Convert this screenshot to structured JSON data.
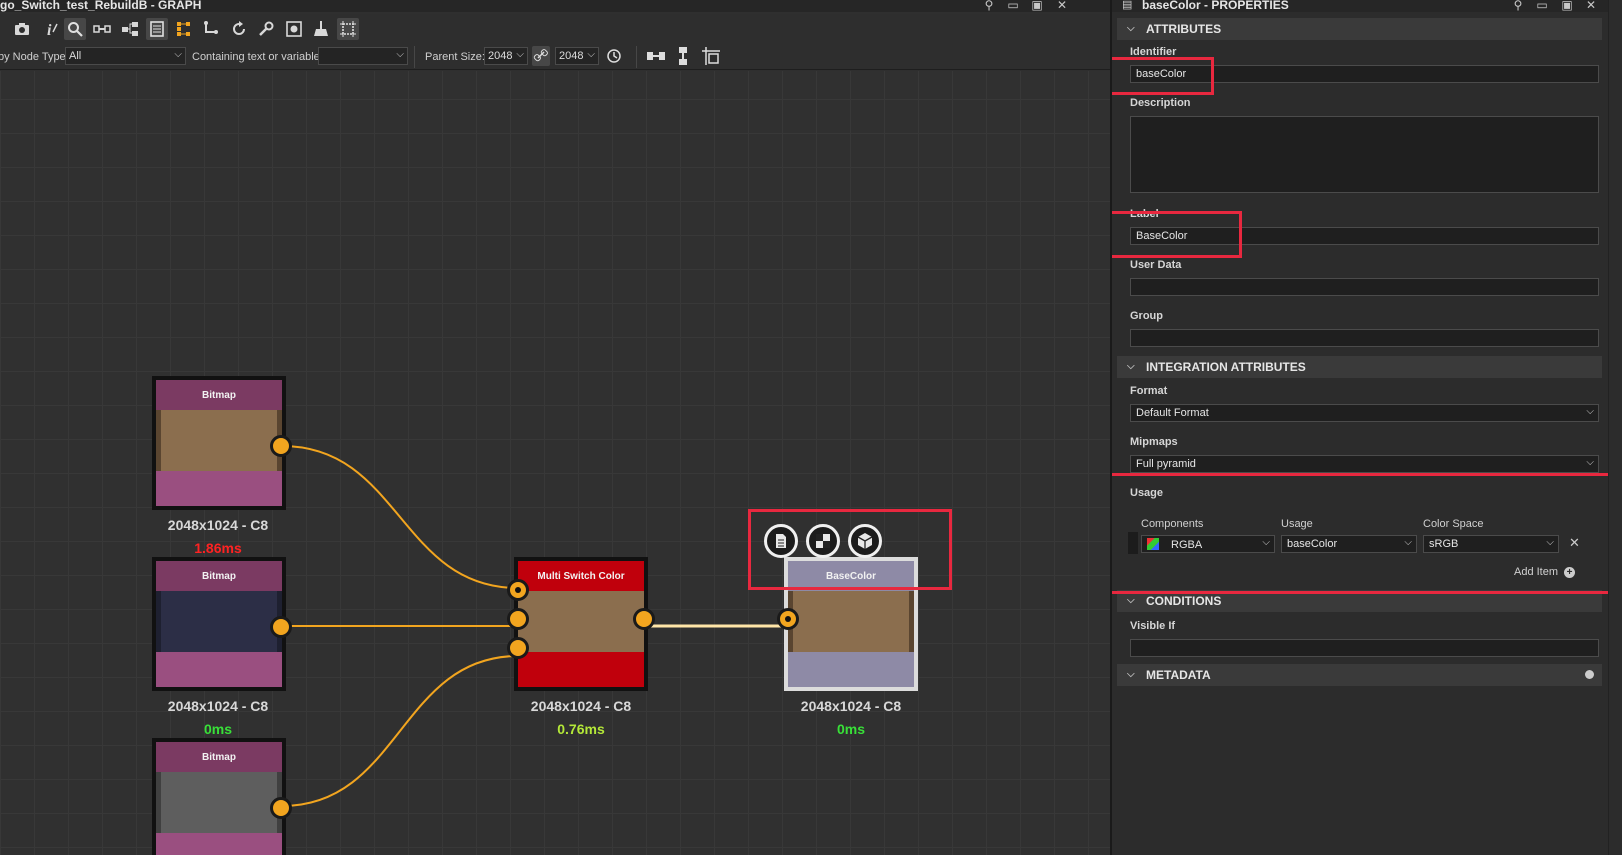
{
  "graph": {
    "title": "go_Switch_test_RebuildB - GRAPH",
    "toolbar_icons": [
      "camera-icon",
      "info-icon",
      "search-icon",
      "link-icon",
      "hierarchy-icon",
      "frame-icon",
      "align-icon",
      "connect-icon",
      "refresh-icon",
      "wrench-icon",
      "snapshot-icon",
      "broom-icon",
      "crop-icon"
    ],
    "filter": {
      "by_node_type_label": "by Node Type",
      "node_type_value": "All",
      "containing_label": "Containing text or variable",
      "containing_value": "",
      "parent_size_label": "Parent Size:",
      "parent_size_w": "2048",
      "parent_size_h": "2048"
    },
    "nodes": [
      {
        "title": "Bitmap",
        "label": "2048x1024 - C8",
        "time": "1.86ms",
        "time_color": "#ff2222",
        "preview": "#8b6e4e"
      },
      {
        "title": "Bitmap",
        "label": "2048x1024 - C8",
        "time": "0ms",
        "time_color": "#38e038",
        "preview": "#2c2e46"
      },
      {
        "title": "Bitmap",
        "label": "",
        "time": "",
        "time_color": "#38e038",
        "preview": "#5e5e5e"
      },
      {
        "title": "Multi Switch Color",
        "label": "2048x1024 - C8",
        "time": "0.76ms",
        "time_color": "#b4e838",
        "preview": "#8b6e4e"
      },
      {
        "title": "BaseColor",
        "label": "2048x1024 - C8",
        "time": "0ms",
        "time_color": "#38e038",
        "preview": "#8b6e4e"
      }
    ]
  },
  "properties": {
    "title": "baseColor - PROPERTIES",
    "sections": {
      "attributes": "ATTRIBUTES",
      "integration": "INTEGRATION ATTRIBUTES",
      "conditions": "CONDITIONS",
      "metadata": "METADATA"
    },
    "identifier": {
      "label": "Identifier",
      "value": "baseColor"
    },
    "description": {
      "label": "Description",
      "value": ""
    },
    "label_field": {
      "label": "Label",
      "value": "BaseColor"
    },
    "user_data": {
      "label": "User Data",
      "value": ""
    },
    "group": {
      "label": "Group",
      "value": ""
    },
    "format": {
      "label": "Format",
      "value": "Default Format"
    },
    "mipmaps": {
      "label": "Mipmaps",
      "value": "Full pyramid"
    },
    "usage": {
      "label": "Usage",
      "col_components": "Components",
      "col_usage": "Usage",
      "col_colorspace": "Color Space",
      "components": "RGBA",
      "usage_value": "baseColor",
      "color_space": "sRGB",
      "add_item": "Add Item"
    },
    "visible_if": {
      "label": "Visible If",
      "value": ""
    }
  }
}
